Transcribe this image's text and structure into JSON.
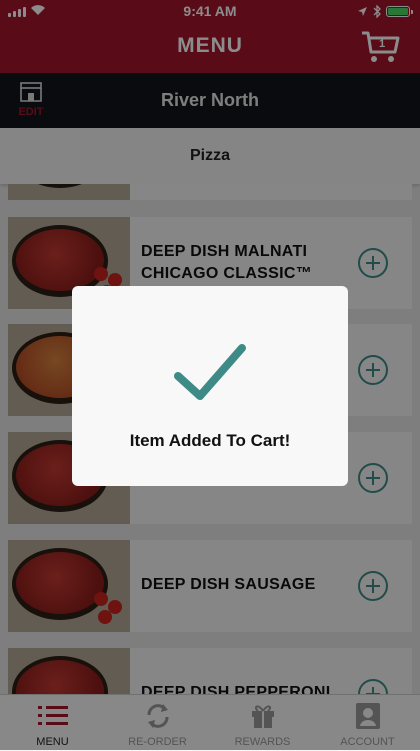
{
  "status_bar": {
    "time": "9:41 AM"
  },
  "header": {
    "title": "MENU",
    "cart_count": "1"
  },
  "location": {
    "edit_label": "EDIT",
    "name": "River North"
  },
  "category": {
    "name": "Pizza"
  },
  "menu_items": [
    {
      "name_line1": "",
      "name_line2": ""
    },
    {
      "name_line1": "DEEP DISH MALNATI",
      "name_line2": "CHICAGO CLASSIC™"
    },
    {
      "name_line1": "",
      "name_line2": ""
    },
    {
      "name_line1": "",
      "name_line2": ""
    },
    {
      "name_line1": "DEEP DISH SAUSAGE",
      "name_line2": ""
    },
    {
      "name_line1": "DEEP DISH PEPPERONI",
      "name_line2": ""
    }
  ],
  "modal": {
    "message": "Item Added To Cart!"
  },
  "tabs": [
    {
      "label": "MENU",
      "icon": "list-icon"
    },
    {
      "label": "RE-ORDER",
      "icon": "reorder-icon"
    },
    {
      "label": "REWARDS",
      "icon": "gift-icon"
    },
    {
      "label": "ACCOUNT",
      "icon": "account-icon"
    }
  ],
  "colors": {
    "brand": "#a2152c",
    "accent": "#3e8a86",
    "dark_bar": "#11141c"
  }
}
